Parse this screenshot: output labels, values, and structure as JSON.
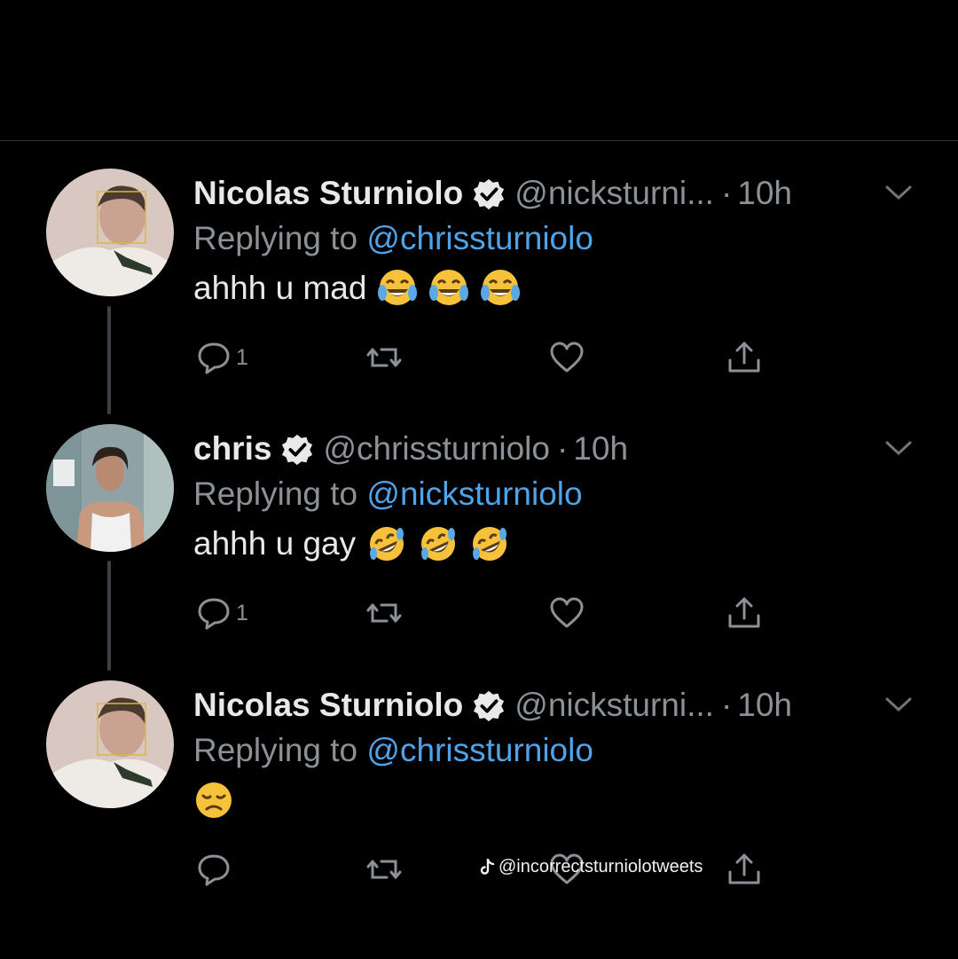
{
  "tweets": [
    {
      "name": "Nicolas Sturniolo",
      "handle": "@nicksturni...",
      "time": "10h",
      "replying_prefix": "Replying to ",
      "replying_to": "@chrissturniolo",
      "text": "ahhh u mad",
      "emojis": [
        "face-with-tears-of-joy",
        "face-with-tears-of-joy",
        "face-with-tears-of-joy"
      ],
      "reply_count": "1"
    },
    {
      "name": "chris",
      "handle": "@chrissturniolo",
      "time": "10h",
      "replying_prefix": "Replying to ",
      "replying_to": "@nicksturniolo",
      "text": "ahhh u gay",
      "emojis": [
        "rolling-on-the-floor-laughing",
        "rolling-on-the-floor-laughing",
        "rolling-on-the-floor-laughing"
      ],
      "reply_count": "1"
    },
    {
      "name": "Nicolas Sturniolo",
      "handle": "@nicksturni...",
      "time": "10h",
      "replying_prefix": "Replying to ",
      "replying_to": "@chrissturniolo",
      "text": "",
      "emojis": [
        "disappointed-face"
      ],
      "reply_count": ""
    }
  ],
  "separator": "·",
  "watermark": "@incorrectsturniolotweets",
  "colors": {
    "background": "#000000",
    "link": "#4fa3e8",
    "muted": "#8b9196",
    "text": "#e7e9ea"
  }
}
